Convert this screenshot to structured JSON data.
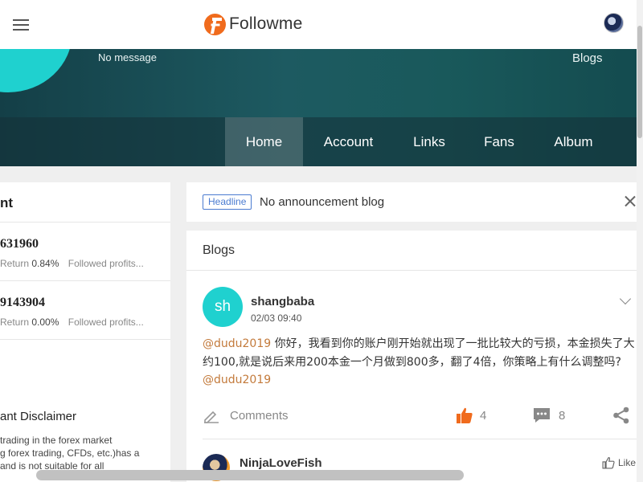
{
  "header": {
    "brand": "Followme",
    "menu_icon": "hamburger-icon",
    "avatar_icon": "user-avatar"
  },
  "banner": {
    "message": "No message",
    "blogs_link": "Blogs",
    "nav": [
      {
        "label": "Home",
        "active": true
      },
      {
        "label": "Account",
        "active": false
      },
      {
        "label": "Links",
        "active": false
      },
      {
        "label": "Fans",
        "active": false
      },
      {
        "label": "Album",
        "active": false
      }
    ]
  },
  "left": {
    "title": "nt",
    "accounts": [
      {
        "number": "631960",
        "return_label": "Return",
        "return_value": "0.84%",
        "followed": "Followed profits..."
      },
      {
        "number": "9143904",
        "return_label": "Return",
        "return_value": "0.00%",
        "followed": "Followed profits..."
      }
    ],
    "disclaimer_title": "ant Disclaimer",
    "disclaimer_lines": [
      "trading in the forex market",
      "g forex trading, CFDs, etc.)has a",
      "and is not suitable for all"
    ]
  },
  "headline": {
    "badge": "Headline",
    "text": "No announcement blog",
    "close_icon": "close-icon"
  },
  "blogs": {
    "title": "Blogs",
    "post": {
      "avatar_initials": "sh",
      "author": "shangbaba",
      "date": "02/03 09:40",
      "mention": "@dudu2019",
      "body": " 你好，我看到你的账户刚开始就出现了一批比较大的亏损，本金损失了大约100,就是说后来用200本金一个月做到800多，翻了4倍，你策略上有什么调整吗?",
      "mention_tail": "@dudu2019",
      "comments_label": "Comments",
      "likes": "4",
      "comment_count": "8"
    },
    "post2": {
      "author": "NinjaLoveFish",
      "like_label": "Like"
    }
  },
  "colors": {
    "accent_orange": "#f06b1d",
    "teal": "#1fd1cf",
    "badge_blue": "#4a7bd0",
    "mention": "#c37a3b"
  }
}
